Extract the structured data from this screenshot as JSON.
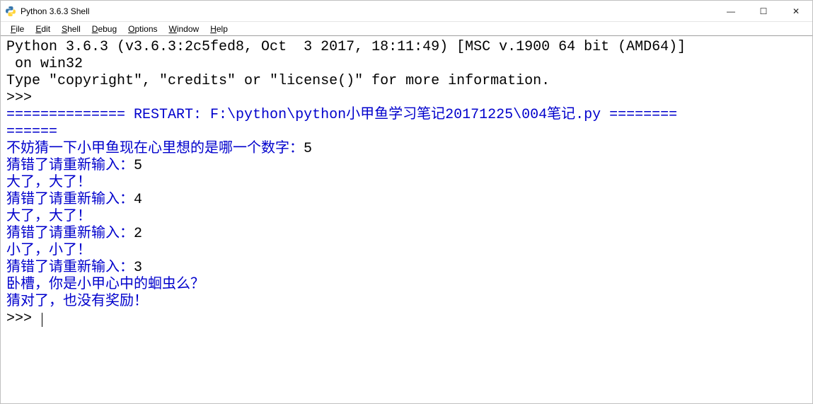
{
  "window": {
    "title": "Python 3.6.3 Shell",
    "buttons": {
      "min": "—",
      "max": "☐",
      "close": "✕"
    }
  },
  "menu": {
    "file": {
      "u": "F",
      "rest": "ile"
    },
    "edit": {
      "u": "E",
      "rest": "dit"
    },
    "shell": {
      "u": "S",
      "rest": "hell"
    },
    "debug": {
      "u": "D",
      "rest": "ebug"
    },
    "options": {
      "u": "O",
      "rest": "ptions"
    },
    "window": {
      "u": "W",
      "rest": "indow"
    },
    "help": {
      "u": "H",
      "rest": "elp"
    }
  },
  "console": {
    "banner1": "Python 3.6.3 (v3.6.3:2c5fed8, Oct  3 2017, 18:11:49) [MSC v.1900 64 bit (AMD64)]",
    "banner2": " on win32",
    "banner3": "Type \"copyright\", \"credits\" or \"license()\" for more information.",
    "prompt": ">>> ",
    "restart1": "============== RESTART: F:\\python\\python小甲鱼学习笔记20171225\\004笔记.py ========",
    "restart2": "======",
    "p1": "不妨猜一下小甲鱼现在心里想的是哪一个数字：",
    "in1": "5",
    "p2": "猜错了请重新输入：",
    "in2": "5",
    "r1": "大了，大了！",
    "in3": "4",
    "r2": "大了，大了！",
    "in4": "2",
    "r3": "小了，小了！",
    "in5": "3",
    "r4": "卧槽，你是小甲心中的蛔虫么？",
    "r5": "猜对了，也没有奖励！"
  }
}
